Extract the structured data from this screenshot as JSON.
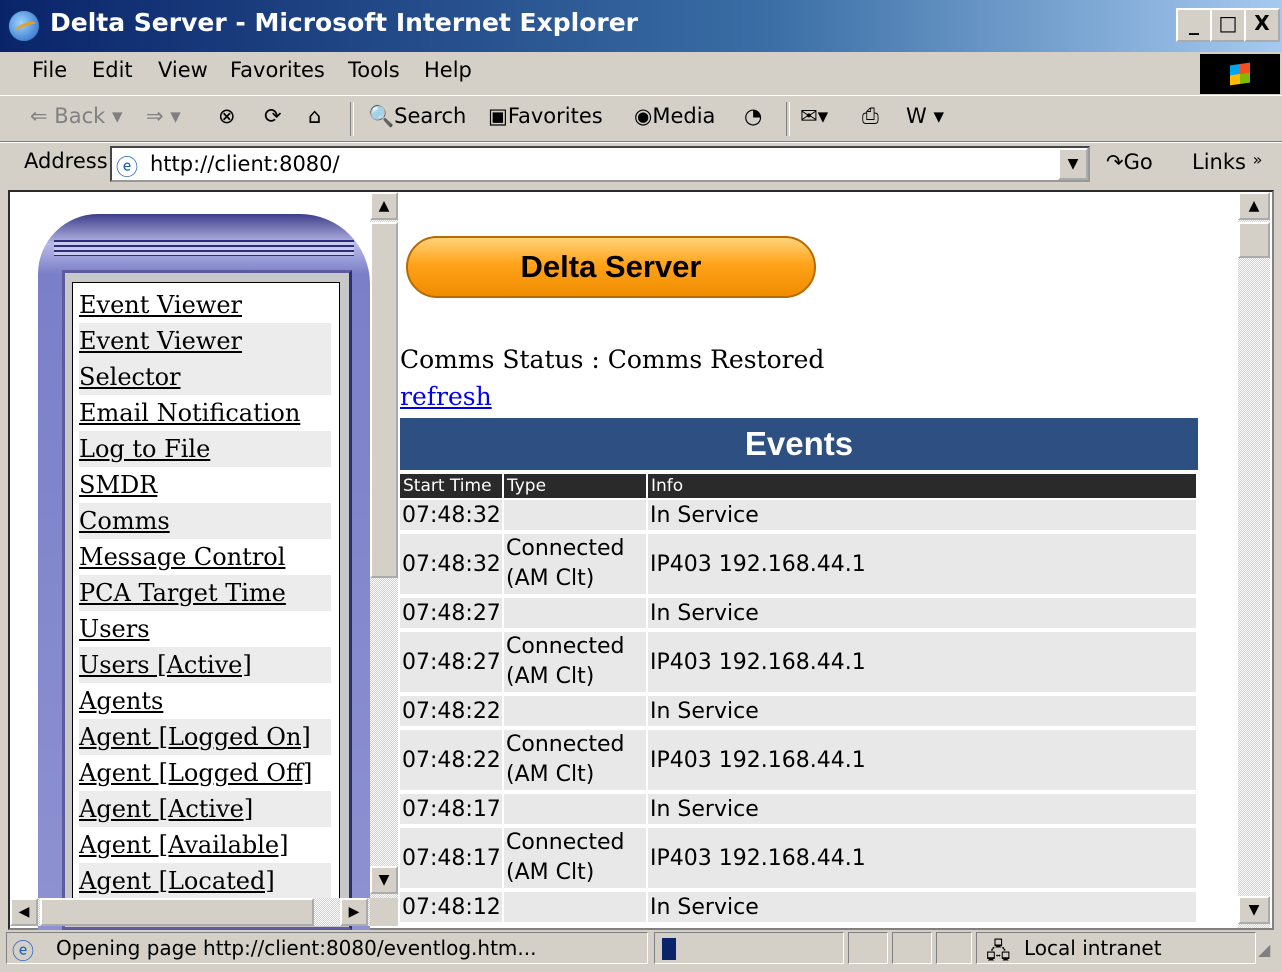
{
  "window": {
    "title": "Delta Server - Microsoft Internet Explorer",
    "min": "_",
    "max": "□",
    "close": "X"
  },
  "menu": {
    "file": "File",
    "edit": "Edit",
    "view": "View",
    "favorites": "Favorites",
    "tools": "Tools",
    "help": "Help"
  },
  "toolbar": {
    "back": "Back",
    "search": "Search",
    "favorites": "Favorites",
    "media": "Media"
  },
  "address": {
    "label": "Address",
    "url": "http://client:8080/",
    "go": "Go",
    "links": "Links"
  },
  "nav": {
    "items": [
      "Event Viewer",
      "Event Viewer",
      "Selector",
      "Email Notification",
      "Log to File",
      "SMDR",
      "Comms",
      "Message Control",
      "PCA Target Time",
      "Users",
      "Users [Active]",
      "Agents",
      "Agent [Logged On]",
      "Agent [Logged Off]",
      "Agent [Active]",
      "Agent [Available]",
      "Agent [Located]"
    ]
  },
  "main": {
    "banner": "Delta Server",
    "comms_status": "Comms Status : Comms Restored",
    "refresh": "refresh",
    "events_title": "Events",
    "columns": [
      "Start Time",
      "Type",
      "Info"
    ],
    "rows": [
      {
        "time": "07:48:32",
        "type": "",
        "info": "In Service"
      },
      {
        "time": "07:48:32",
        "type": "Connected (AM Clt)",
        "info": "IP403 192.168.44.1"
      },
      {
        "time": "07:48:27",
        "type": "",
        "info": "In Service"
      },
      {
        "time": "07:48:27",
        "type": "Connected (AM Clt)",
        "info": "IP403 192.168.44.1"
      },
      {
        "time": "07:48:22",
        "type": "",
        "info": "In Service"
      },
      {
        "time": "07:48:22",
        "type": "Connected (AM Clt)",
        "info": "IP403 192.168.44.1"
      },
      {
        "time": "07:48:17",
        "type": "",
        "info": "In Service"
      },
      {
        "time": "07:48:17",
        "type": "Connected (AM Clt)",
        "info": "IP403 192.168.44.1"
      },
      {
        "time": "07:48:12",
        "type": "",
        "info": "In Service"
      }
    ]
  },
  "status": {
    "text": "Opening page http://client:8080/eventlog.htm...",
    "zone": "Local intranet"
  }
}
